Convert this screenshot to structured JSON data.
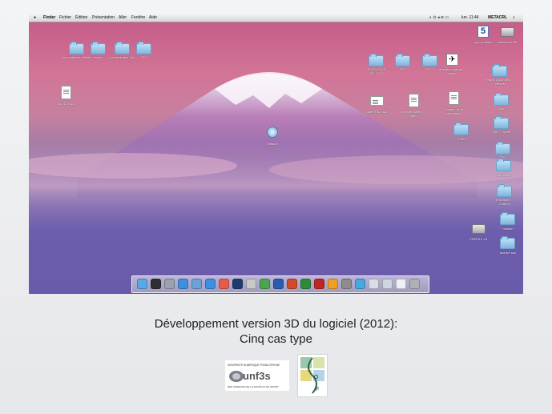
{
  "menubar": {
    "apple": "",
    "items": [
      "Finder",
      "Fichier",
      "Édition",
      "Présentation",
      "Aller",
      "Fenêtre",
      "Aide"
    ],
    "clock": "lun. 11:44",
    "user": "METACRL"
  },
  "desktop": {
    "top_left_folders": [
      "les matériels utilisés",
      "avion",
      "présentation 3dx",
      "PPX"
    ],
    "left_doc": "3D 3D 2012",
    "center_app": "Metacrl",
    "right_top": [
      {
        "label": "EXECUTIVE 3D...DOC",
        "kind": "folder"
      },
      {
        "label": "EYE",
        "kind": "folder"
      },
      {
        "label": "DOCS",
        "kind": "folder"
      },
      {
        "label": "simulation gauge ... toutes",
        "kind": "app"
      }
    ],
    "right_middle": [
      {
        "label": "Carte ENJ.doc",
        "kind": "doc"
      },
      {
        "label": "lecture Actes ... (doc)",
        "kind": "doc"
      },
      {
        "label": "Travaux de la simulation",
        "kind": "doc"
      },
      {
        "label": "X Box",
        "kind": "folder"
      }
    ],
    "right_column": [
      {
        "label": "sys_updates",
        "kind": "app"
      },
      {
        "label": "Macintosh HD",
        "kind": "drive"
      },
      {
        "label": "mises à jour des ... élèves",
        "kind": "folder"
      },
      {
        "label": "sys",
        "kind": "folder"
      },
      {
        "label": "mini ... lycée",
        "kind": "folder"
      },
      {
        "label": "PV1",
        "kind": "folder"
      },
      {
        "label": "emmanuel",
        "kind": "folder"
      },
      {
        "label": "ensemble ... martine",
        "kind": "folder"
      },
      {
        "label": "metacrl",
        "kind": "folder"
      },
      {
        "label": "archive sos",
        "kind": "folder"
      }
    ],
    "bottom_right_drive": "PREPA 4 15"
  },
  "dock": {
    "icons": [
      "finder-icon",
      "dashboard-icon",
      "launchpad-icon",
      "safari-icon",
      "mail-icon",
      "appstore-icon",
      "calendar-icon",
      "photoshop-icon",
      "preview-icon",
      "itunes-icon",
      "word-icon",
      "powerpoint-icon",
      "excel-icon",
      "acrobat-icon",
      "sync-icon",
      "system-preferences-icon",
      "metacrl-icon",
      "documents-icon",
      "downloads-icon",
      "display-icon",
      "trash-icon"
    ],
    "colors": [
      "#5aa7e8",
      "#2f2f2f",
      "#9aa3ad",
      "#3f8fe0",
      "#6ba3d9",
      "#3c8fe3",
      "#e85b4b",
      "#1c3c6e",
      "#c9c9c9",
      "#4aa54d",
      "#2a5cae",
      "#d04a2b",
      "#2f8a3a",
      "#c02525",
      "#f0a020",
      "#8c8c8c",
      "#44aadd",
      "#d8dde6",
      "#d0d6e0",
      "#eef0f4",
      "#b0b0b8"
    ]
  },
  "caption": {
    "line1": "Développement version 3D du logiciel (2012):",
    "line2": "Cinq cas type"
  },
  "logos": {
    "unf3s_brand": "unf3s",
    "unf3s_top": "UNIVERSITÉ NUMÉRIQUE FRANCOPHONE",
    "unf3s_bottom": "DES SCIENCES DE LA SANTÉ ET DU SPORT",
    "sfb_letters": [
      "O",
      "F"
    ]
  }
}
